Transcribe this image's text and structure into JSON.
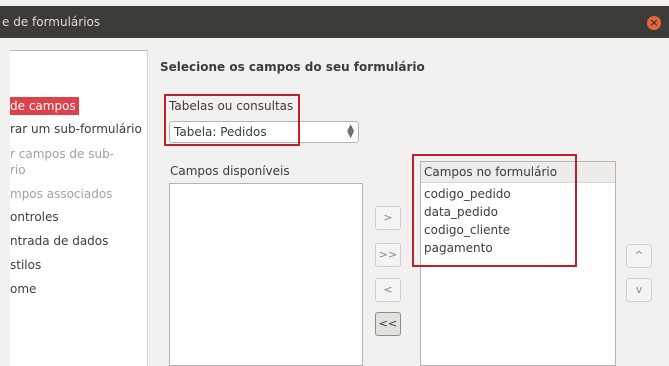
{
  "window": {
    "title": "e de formulários",
    "close_glyph": "×"
  },
  "sidebar": {
    "steps": [
      {
        "label": "de campos",
        "state": "active"
      },
      {
        "label": "rar um sub-formulário",
        "state": "normal"
      },
      {
        "label": "r campos de sub-",
        "state": "disabled"
      },
      {
        "label": "rio",
        "state": "disabled"
      },
      {
        "label": "mpos associados",
        "state": "disabled"
      },
      {
        "label": "ontroles",
        "state": "normal"
      },
      {
        "label": "ntrada de dados",
        "state": "normal"
      },
      {
        "label": "stilos",
        "state": "normal"
      },
      {
        "label": "ome",
        "state": "normal"
      }
    ]
  },
  "main": {
    "title": "Selecione os campos do seu formulário",
    "tables_label": "Tabelas ou consultas",
    "table_selected": "Tabela: Pedidos",
    "available_label": "Campos disponíveis",
    "available_fields": [],
    "form_fields_label": "Campos no formulário",
    "form_fields": [
      "codigo_pedido",
      "data_pedido",
      "codigo_cliente",
      "pagamento"
    ],
    "buttons": {
      "add": ">",
      "add_all": ">>",
      "remove": "<",
      "remove_all": "<<",
      "up": "^",
      "down": "v"
    }
  },
  "colors": {
    "highlight": "#c0202a",
    "active_step": "#dd4149",
    "titlebar": "#3c3b37"
  }
}
